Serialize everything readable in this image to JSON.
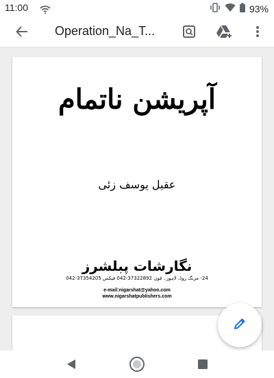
{
  "status_bar": {
    "time": "11:00",
    "battery_percent": "93%",
    "icons": [
      "wifi-icon",
      "vibrate-icon",
      "wifi-icon",
      "battery-icon"
    ]
  },
  "app_bar": {
    "title": "Operation_Na_T...",
    "icons": [
      "back-arrow-icon",
      "search-in-document-icon",
      "add-to-drive-icon",
      "more-vert-icon"
    ]
  },
  "document": {
    "title": "آپریشن ناتمام",
    "author": "عقیل یوسف زئی",
    "publisher": {
      "name": "نگارشات پبلشرز",
      "address": "24- مزنگ روڈ، لاہور۔ فون 37322892-042 فیکس 37354205-042",
      "email": "e-mail:nigarshat@yahoo.com",
      "website": "www.nigarshatpublishers.com"
    }
  },
  "fab": {
    "icon": "edit-pencil-icon"
  },
  "nav_bar": {
    "icons": [
      "nav-back-icon",
      "nav-home-icon",
      "nav-recents-icon"
    ]
  },
  "colors": {
    "accent": "#1a73e8",
    "app_bar_bg": "#ffffff",
    "viewer_bg": "#eeeeee"
  }
}
